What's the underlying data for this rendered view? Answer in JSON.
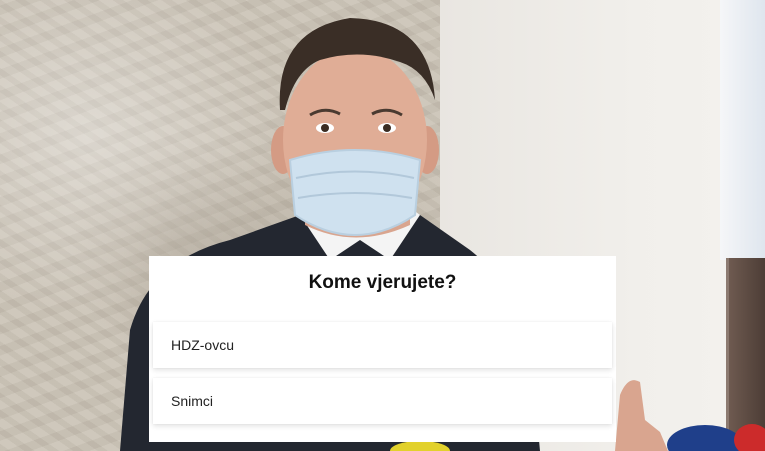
{
  "poll": {
    "question": "Kome vjerujete?",
    "options": [
      {
        "label": "HDZ-ovcu"
      },
      {
        "label": "Snimci"
      }
    ]
  },
  "colors": {
    "card_background": "#ffffff",
    "text": "#111111"
  }
}
